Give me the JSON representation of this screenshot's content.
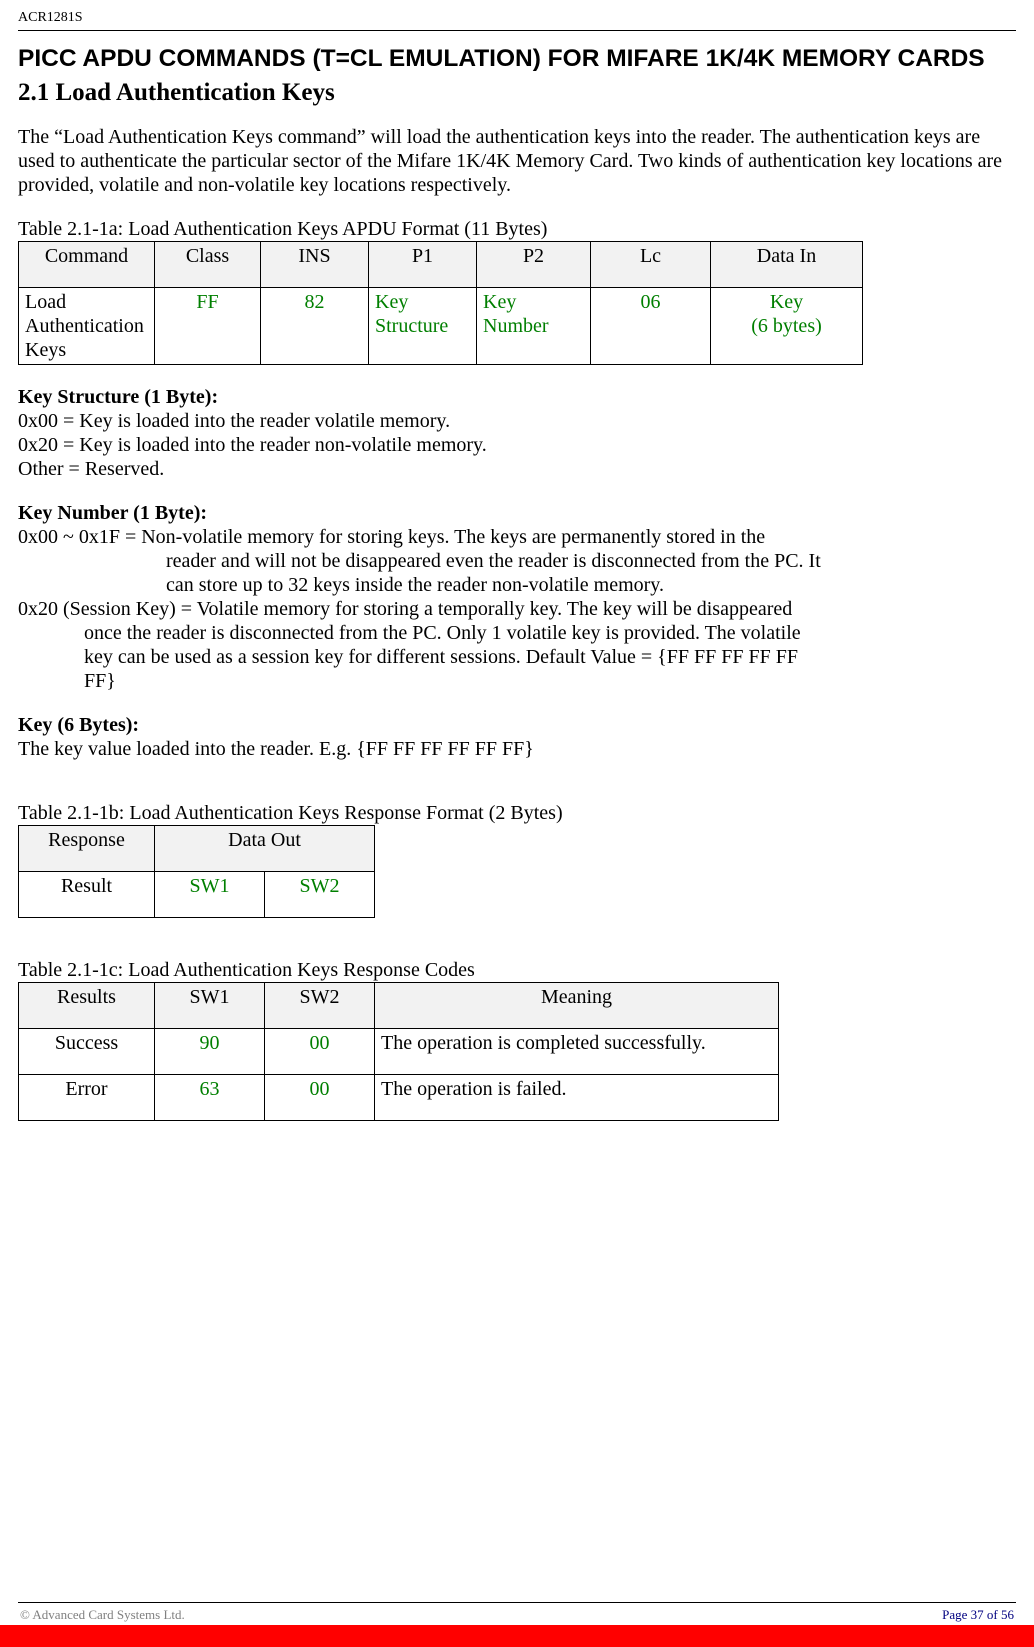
{
  "header": {
    "model": "ACR1281S"
  },
  "h1": "PICC APDU COMMANDS (T=CL EMULATION) FOR MIFARE 1K/4K MEMORY CARDS",
  "h2": "2.1 Load Authentication Keys",
  "intro": "The “Load Authentication Keys command” will load the authentication keys into the reader. The authentication keys are used to authenticate the particular sector of the Mifare 1K/4K Memory Card. Two kinds of authentication key locations are provided, volatile and non-volatile key locations respectively.",
  "table1": {
    "caption": "Table 2.1-1a: Load Authentication Keys APDU Format (11 Bytes)",
    "headers": [
      "Command",
      "Class",
      "INS",
      "P1",
      "P2",
      "Lc",
      "Data In"
    ],
    "row": {
      "cmd": "Load Authentication Keys",
      "class": "FF",
      "ins": "82",
      "p1": "Key Structure",
      "p2": "Key Number",
      "lc": "06",
      "datain_l1": "Key",
      "datain_l2": "(6 bytes)"
    }
  },
  "ks": {
    "title": "Key Structure (1 Byte):",
    "l1": "0x00 = Key is loaded into the reader volatile memory.",
    "l2": "0x20 = Key is loaded into the reader non-volatile memory.",
    "l3": "Other = Reserved."
  },
  "kn": {
    "title": "Key Number (1 Byte):",
    "a1": "0x00 ~ 0x1F = Non-volatile memory for storing keys. The keys are permanently stored in the",
    "a2": "reader and will not be disappeared even the reader is disconnected from the PC. It",
    "a3": "can store up to 32 keys inside the reader non-volatile memory.",
    "b1": "0x20 (Session Key) = Volatile memory for storing a temporally key. The key will be disappeared",
    "b2": "once the reader is disconnected from the PC. Only 1 volatile key is provided. The volatile",
    "b3": "key can be used as a session key for different sessions. Default Value = {FF FF FF FF FF",
    "b4": "FF}"
  },
  "key6": {
    "title": "Key (6 Bytes):",
    "l1": "The key value loaded into the reader. E.g. {FF FF FF FF FF FF}"
  },
  "table2": {
    "caption": "Table 2.1-1b: Load Authentication Keys Response Format (2 Bytes)",
    "headers": [
      "Response",
      "Data Out"
    ],
    "row": {
      "resp": "Result",
      "sw1": "SW1",
      "sw2": "SW2"
    }
  },
  "table3": {
    "caption": "Table 2.1-1c: Load Authentication Keys Response Codes",
    "headers": [
      "Results",
      "SW1",
      "SW2",
      "Meaning"
    ],
    "rows": [
      {
        "r": "Success",
        "s1": "90",
        "s2": "00",
        "m": "The operation is completed successfully."
      },
      {
        "r": "Error",
        "s1": "63",
        "s2": "00",
        "m": "The operation is failed."
      }
    ]
  },
  "footer": {
    "copyright": "© Advanced Card Systems Ltd.",
    "page": "Page 37 of 56"
  }
}
